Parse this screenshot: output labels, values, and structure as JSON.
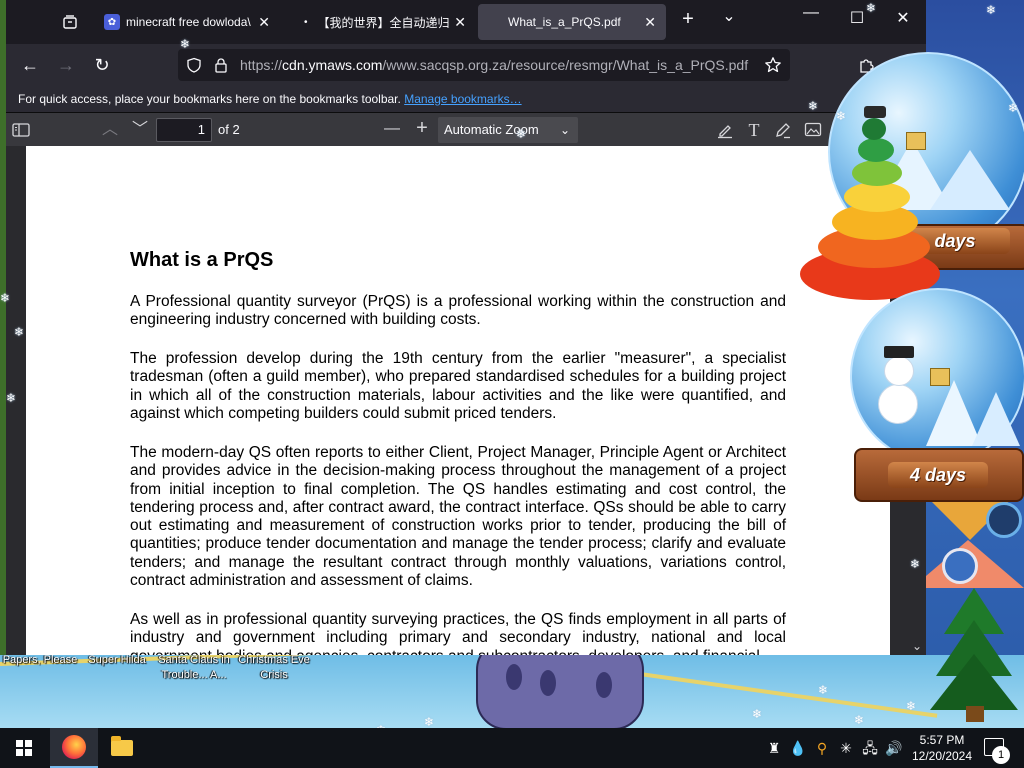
{
  "browser": {
    "tabs": [
      {
        "title": "minecraft free dowloda\\",
        "favicon": "paw-favicon-icon"
      },
      {
        "title": "【我的世界】全自动递归",
        "favicon": "dot-favicon-icon"
      },
      {
        "title": "What_is_a_PrQS.pdf",
        "favicon": "",
        "active": true
      }
    ],
    "url": {
      "scheme": "https://",
      "host": "cdn.ymaws.com",
      "path": "/www.sacqsp.org.za/resource/resmgr/What_is_a_PrQS.pdf"
    },
    "bookmarks": {
      "message": "For quick access, place your bookmarks here on the bookmarks toolbar.",
      "link": "Manage bookmarks…"
    }
  },
  "pdf_toolbar": {
    "page_number": "1",
    "page_count": "of 2",
    "zoom": "Automatic Zoom"
  },
  "document": {
    "heading": "What is a PrQS",
    "paragraphs": [
      "A Professional quantity surveyor (PrQS) is a professional working within the construction and engineering industry concerned with building costs.",
      "The profession develop during the 19th century from the earlier \"measurer\", a specialist tradesman (often a guild member), who prepared standardised schedules for a building project in which all of the construction materials, labour activities and the like were quantified, and against which competing builders could submit priced tenders.",
      "The modern-day QS often reports to either Client, Project Manager, Principle Agent or Architect and provides advice in the decision-making process throughout the management of a project from initial inception to final completion. The QS handles estimating and cost control, the tendering process and, after contract award, the contract interface. QSs should be able to carry out estimating and measurement of construction works prior to tender, producing the bill of quantities; produce tender documentation and manage the tender process; clarify and evaluate tenders; and manage the resultant contract through monthly valuations, variations control, contract administration and assessment of claims.",
      "As well as in professional quantity surveying practices, the QS finds employment in all parts of industry and government including primary and secondary industry, national and local government bodies and agencies, contractors and subcontractors, developers, and financial"
    ]
  },
  "desktop": {
    "icons": [
      {
        "label": "Papers, Please"
      },
      {
        "label": "Super Hilda"
      },
      {
        "label": "Santa Claus in Trouble... A..."
      },
      {
        "label": "Christmas Eve Crisis"
      }
    ],
    "globes": [
      {
        "label": "days"
      },
      {
        "label": "4 days"
      }
    ]
  },
  "taskbar": {
    "time": "5:57 PM",
    "date": "12/20/2024",
    "notifications": "1"
  },
  "colors": {
    "browser_bg": "#1c1b22",
    "toolbar_bg": "#2b2a33",
    "link": "#45a1ff",
    "taskbar": "#101318"
  }
}
